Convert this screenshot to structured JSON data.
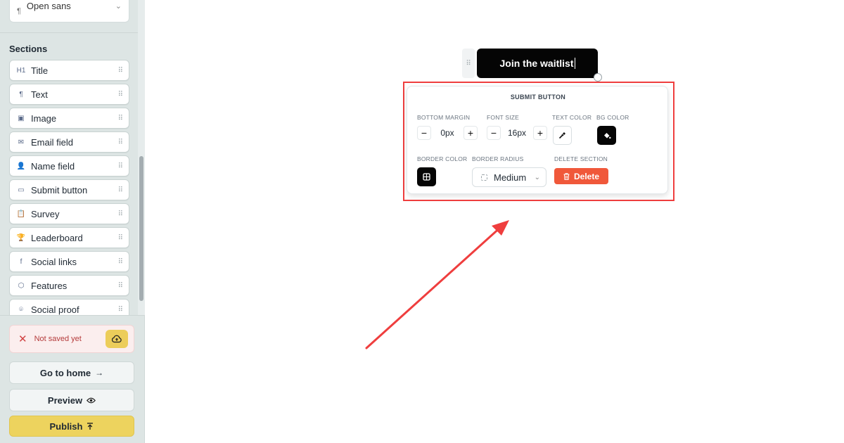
{
  "sidebar": {
    "font_select": {
      "value": "Open sans",
      "icon": "pilcrow-icon"
    },
    "sections_heading": "Sections",
    "sections": [
      {
        "label": "Title",
        "icon": "heading-icon",
        "glyph": "H1"
      },
      {
        "label": "Text",
        "icon": "pilcrow-icon",
        "glyph": "¶"
      },
      {
        "label": "Image",
        "icon": "image-icon",
        "glyph": "▣"
      },
      {
        "label": "Email field",
        "icon": "mail-icon",
        "glyph": "✉"
      },
      {
        "label": "Name field",
        "icon": "user-icon",
        "glyph": "👤"
      },
      {
        "label": "Submit button",
        "icon": "button-icon",
        "glyph": "▭"
      },
      {
        "label": "Survey",
        "icon": "clipboard-icon",
        "glyph": "📋"
      },
      {
        "label": "Leaderboard",
        "icon": "trophy-icon",
        "glyph": "🏆"
      },
      {
        "label": "Social links",
        "icon": "facebook-icon",
        "glyph": "f"
      },
      {
        "label": "Features",
        "icon": "box-icon",
        "glyph": "⬡"
      },
      {
        "label": "Social proof",
        "icon": "user-scan-icon",
        "glyph": "⌾"
      }
    ],
    "save_status": {
      "text": "Not saved yet",
      "icon": "close-icon",
      "save_icon": "cloud-upload-icon"
    },
    "go_home": {
      "label": "Go to home",
      "icon": "arrow-right-icon"
    },
    "preview": {
      "label": "Preview",
      "icon": "eye-icon"
    },
    "publish": {
      "label": "Publish",
      "icon": "upload-icon"
    }
  },
  "canvas": {
    "waitlist_button": {
      "label": "Join the waitlist"
    },
    "popover": {
      "title": "SUBMIT BUTTON",
      "bottom_margin": {
        "label": "BOTTOM MARGIN",
        "value": "0px"
      },
      "font_size": {
        "label": "FONT SIZE",
        "value": "16px"
      },
      "text_color": {
        "label": "TEXT COLOR",
        "icon": "eyedropper-icon",
        "swatch": "#ffffff"
      },
      "bg_color": {
        "label": "BG COLOR",
        "icon": "paint-bucket-icon",
        "swatch": "#050505"
      },
      "border_color": {
        "label": "BORDER COLOR",
        "icon": "border-grid-icon",
        "swatch": "#050505"
      },
      "border_radius": {
        "label": "BORDER RADIUS",
        "value": "Medium"
      },
      "delete_section": {
        "label": "DELETE SECTION",
        "button": "Delete",
        "icon": "trash-icon"
      }
    }
  },
  "colors": {
    "sidebar_bg": "#dde5e4",
    "accent_yellow": "#edd35e",
    "delete_orange": "#f0583a",
    "annotation_red": "#ef3e3e"
  }
}
